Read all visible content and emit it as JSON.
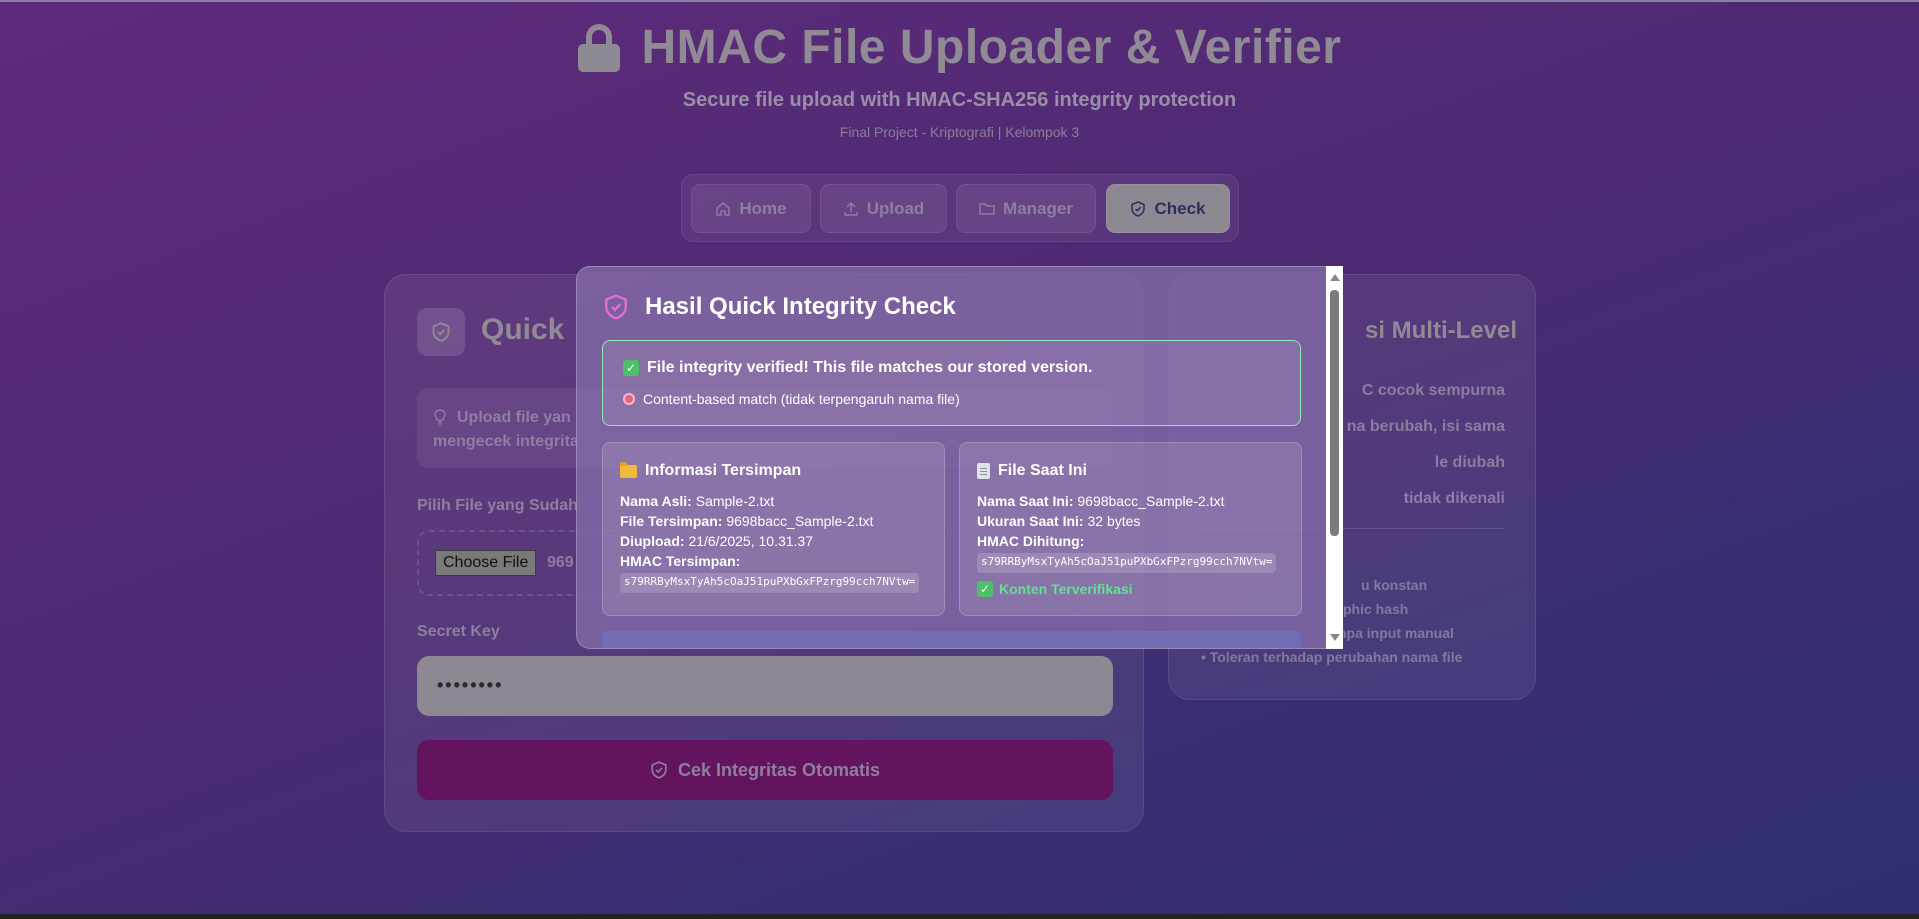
{
  "header": {
    "title": "HMAC File Uploader & Verifier",
    "subtitle": "Secure file upload with HMAC-SHA256 integrity protection",
    "project": "Final Project - Kriptografi | Kelompok 3"
  },
  "nav": {
    "home": "Home",
    "upload": "Upload",
    "manager": "Manager",
    "check": "Check",
    "active": "Check"
  },
  "left_card": {
    "title": "Quick",
    "tip": "Upload file yan mengecek integrita",
    "file_label": "Pilih File yang Sudah",
    "choose_button": "Choose File",
    "file_name": "969",
    "secret_label": "Secret Key",
    "secret_value": "••••••••",
    "check_button": "Cek Integritas Otomatis"
  },
  "right_card": {
    "title": "si Multi-Level",
    "items": [
      "C cocok sempurna",
      "na berubah, isi sama",
      "le diubah",
      "tidak dikenali"
    ],
    "small_items": [
      "u konstan",
      "phic hash",
      "npa input manual",
      "• Toleran terhadap perubahan nama file"
    ]
  },
  "modal": {
    "title": "Hasil Quick Integrity Check",
    "status_main": "File integrity verified! This file matches our stored version.",
    "status_sub": "Content-based match (tidak terpengaruh nama file)",
    "stored": {
      "heading": "Informasi Tersimpan",
      "original_name_label": "Nama Asli:",
      "original_name": "Sample-2.txt",
      "stored_file_label": "File Tersimpan:",
      "stored_file": "9698bacc_Sample-2.txt",
      "uploaded_label": "Diupload:",
      "uploaded": "21/6/2025, 10.31.37",
      "hmac_label": "HMAC Tersimpan:",
      "hmac": "s79RRByMsxTyAh5cOaJ51puPXbGxFPzrg99cch7NVtw="
    },
    "current": {
      "heading": "File Saat Ini",
      "current_name_label": "Nama Saat Ini:",
      "current_name": "9698bacc_Sample-2.txt",
      "size_label": "Ukuran Saat Ini:",
      "size": "32 bytes",
      "hmac_label": "HMAC Dihitung:",
      "hmac": "s79RRByMsxTyAh5cOaJ51puPXbGxFPzrg99cch7NVtw=",
      "verified": "Konten Terverifikasi"
    }
  },
  "colors": {
    "accent_pink": "#e56fd9",
    "success_green": "#5fe38f",
    "primary_button": "#64135f"
  }
}
